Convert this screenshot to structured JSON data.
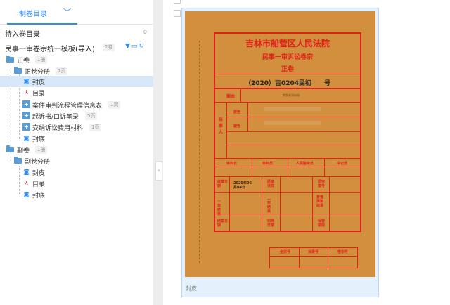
{
  "tabs": {
    "active_label": "制卷目录"
  },
  "pending": {
    "title": "待入卷目录",
    "count": "0"
  },
  "template": {
    "title": "民事一审卷宗统一模板(导入)",
    "badge": "2卷"
  },
  "tree": [
    {
      "id": "zhengjuan",
      "label": "正卷",
      "badge": "1册"
    },
    {
      "id": "zhengjuan-fence",
      "label": "正卷分册",
      "badge": "7页"
    },
    {
      "id": "fengpi-1",
      "label": "封皮",
      "badge": ""
    },
    {
      "id": "mulu-1",
      "label": "目录",
      "badge": ""
    },
    {
      "id": "anjian",
      "label": "案件审判流程管理信息表",
      "badge": "1页"
    },
    {
      "id": "qisu",
      "label": "起诉书/口诉笔录",
      "badge": "5页"
    },
    {
      "id": "jiaona",
      "label": "交纳诉讼费用材料",
      "badge": "1页"
    },
    {
      "id": "fengdi-1",
      "label": "封底",
      "badge": ""
    },
    {
      "id": "fujuan",
      "label": "副卷",
      "badge": "1册"
    },
    {
      "id": "fujuan-fence",
      "label": "副卷分册",
      "badge": ""
    },
    {
      "id": "fengpi-2",
      "label": "封皮",
      "badge": ""
    },
    {
      "id": "mulu-2",
      "label": "目录",
      "badge": ""
    },
    {
      "id": "fengdi-2",
      "label": "封底",
      "badge": ""
    }
  ],
  "cover": {
    "court": "吉林市船营区人民法院",
    "case_type": "民事一审诉讼卷宗",
    "volume": "正卷",
    "case_no": "（2020）吉0204民初　　号",
    "anyou_label": "案由",
    "anyou_value": "劳务合同纠纷",
    "party_label": "当事人",
    "plaintiff_label": "原告",
    "defendant_label": "被告",
    "judge_chief": "审判长",
    "judge": "审判员",
    "juror": "人民陪审员",
    "clerk": "书记员",
    "receive_date_label": "收案日期",
    "receive_date": "2020年06月04日",
    "first_inst_label": "原审法院",
    "orig_no_label": "原审案号",
    "result1_label": "一审结果",
    "result2_label": "二审结果",
    "retrial_label": "复查再审结果",
    "close_date_label": "结案日期",
    "archive_date_label": "归档日期",
    "keep_label": "保管期限",
    "bottom_a": "全宗号",
    "bottom_b": "目录号",
    "bottom_c": "卷宗号"
  },
  "card_label": "封皮"
}
